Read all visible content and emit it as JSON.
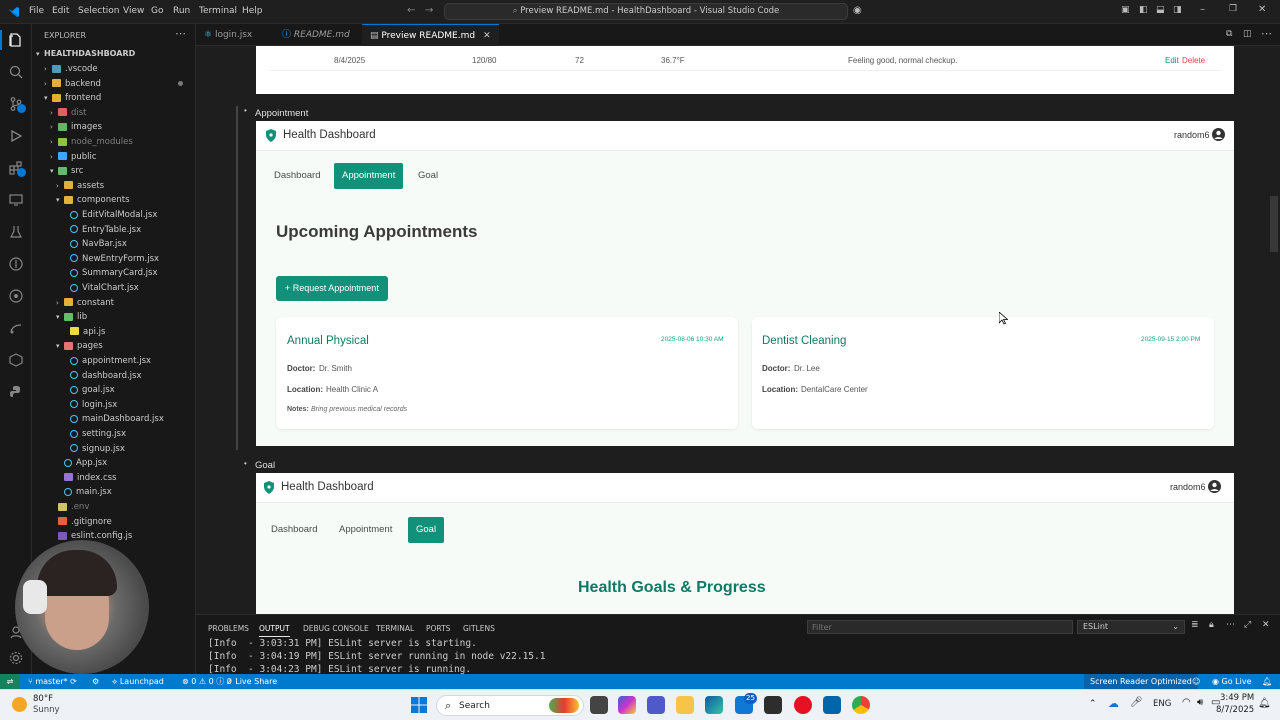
{
  "titlebar": {
    "menu": [
      "File",
      "Edit",
      "Selection",
      "View",
      "Go",
      "Run",
      "Terminal",
      "Help"
    ],
    "command_center": "Preview README.md - HealthDashboard - Visual Studio Code"
  },
  "explorer": {
    "header": "EXPLORER",
    "root": "HEALTHDASHBOARD",
    "items": [
      {
        "label": ".vscode",
        "depth": 1,
        "kind": "folder-closed",
        "color": "#519aba"
      },
      {
        "label": "backend",
        "depth": 1,
        "kind": "folder-closed",
        "color": "#e2b13c"
      },
      {
        "label": "frontend",
        "depth": 1,
        "kind": "folder-open",
        "color": "#e2b13c"
      },
      {
        "label": "dist",
        "depth": 2,
        "kind": "folder-closed",
        "color": "#e05f5f",
        "dim": true
      },
      {
        "label": "images",
        "depth": 2,
        "kind": "folder-closed",
        "color": "#5fb85f"
      },
      {
        "label": "node_modules",
        "depth": 2,
        "kind": "folder-closed",
        "color": "#8bc34a",
        "dim": true
      },
      {
        "label": "public",
        "depth": 2,
        "kind": "folder-closed",
        "color": "#42a5f5"
      },
      {
        "label": "src",
        "depth": 2,
        "kind": "folder-open",
        "color": "#66bb6a"
      },
      {
        "label": "assets",
        "depth": 3,
        "kind": "folder-closed",
        "color": "#e2b13c"
      },
      {
        "label": "components",
        "depth": 3,
        "kind": "folder-open",
        "color": "#e2b13c"
      },
      {
        "label": "EditVitalModal.jsx",
        "depth": 4,
        "kind": "react",
        "color": "#4fc3f7"
      },
      {
        "label": "EntryTable.jsx",
        "depth": 4,
        "kind": "react",
        "color": "#4fc3f7"
      },
      {
        "label": "NavBar.jsx",
        "depth": 4,
        "kind": "react",
        "color": "#4fc3f7"
      },
      {
        "label": "NewEntryForm.jsx",
        "depth": 4,
        "kind": "react",
        "color": "#4fc3f7"
      },
      {
        "label": "SummaryCard.jsx",
        "depth": 4,
        "kind": "react",
        "color": "#4fc3f7"
      },
      {
        "label": "VitalChart.jsx",
        "depth": 4,
        "kind": "react",
        "color": "#4fc3f7"
      },
      {
        "label": "constant",
        "depth": 3,
        "kind": "folder-closed",
        "color": "#e2b13c"
      },
      {
        "label": "lib",
        "depth": 3,
        "kind": "folder-open",
        "color": "#66bb6a"
      },
      {
        "label": "api.js",
        "depth": 4,
        "kind": "js",
        "color": "#f0d84a"
      },
      {
        "label": "pages",
        "depth": 3,
        "kind": "folder-open",
        "color": "#e57373"
      },
      {
        "label": "appointment.jsx",
        "depth": 4,
        "kind": "react",
        "color": "#4fc3f7"
      },
      {
        "label": "dashboard.jsx",
        "depth": 4,
        "kind": "react",
        "color": "#4fc3f7"
      },
      {
        "label": "goal.jsx",
        "depth": 4,
        "kind": "react",
        "color": "#4fc3f7"
      },
      {
        "label": "login.jsx",
        "depth": 4,
        "kind": "react",
        "color": "#4fc3f7"
      },
      {
        "label": "mainDashboard.jsx",
        "depth": 4,
        "kind": "react",
        "color": "#4fc3f7"
      },
      {
        "label": "setting.jsx",
        "depth": 4,
        "kind": "react",
        "color": "#4fc3f7"
      },
      {
        "label": "signup.jsx",
        "depth": 4,
        "kind": "react",
        "color": "#4fc3f7"
      },
      {
        "label": "App.jsx",
        "depth": 3,
        "kind": "react",
        "color": "#4fc3f7"
      },
      {
        "label": "index.css",
        "depth": 3,
        "kind": "css",
        "color": "#9575cd"
      },
      {
        "label": "main.jsx",
        "depth": 3,
        "kind": "react",
        "color": "#4fc3f7"
      },
      {
        "label": ".env",
        "depth": 2,
        "kind": "env",
        "color": "#d4c26a",
        "dim": true
      },
      {
        "label": ".gitignore",
        "depth": 2,
        "kind": "git",
        "color": "#e0643a"
      },
      {
        "label": "eslint.config.js",
        "depth": 2,
        "kind": "eslint",
        "color": "#7e57c2"
      }
    ]
  },
  "tabs": [
    {
      "label": "login.jsx",
      "active": false,
      "italic": false
    },
    {
      "label": "README.md",
      "active": false,
      "italic": true
    },
    {
      "label": "Preview README.md",
      "active": true,
      "italic": false
    }
  ],
  "preview": {
    "vitals_row": {
      "date": "8/4/2025",
      "bp": "120/80",
      "hr": "72",
      "temp": "36.7°F",
      "notes": "Feeling good, normal checkup.",
      "edit": "Edit",
      "delete": "Delete"
    },
    "appointment_bullet": "Appointment",
    "goal_bullet": "Goal",
    "app_title": "Health Dashboard",
    "username": "random6",
    "nav": [
      "Dashboard",
      "Appointment",
      "Goal"
    ],
    "appointments_heading": "Upcoming Appointments",
    "request_button": "+ Request Appointment",
    "appointments": [
      {
        "title": "Annual Physical",
        "datetime": "2025-08-06 10:30 AM",
        "doctor_label": "Doctor:",
        "doctor": "Dr. Smith",
        "location_label": "Location:",
        "location": "Health Clinic A",
        "notes_label": "Notes:",
        "notes": "Bring previous medical records"
      },
      {
        "title": "Dentist Cleaning",
        "datetime": "2025-09-15 2:00 PM",
        "doctor_label": "Doctor:",
        "doctor": "Dr. Lee",
        "location_label": "Location:",
        "location": "DentalCare Center"
      }
    ],
    "goals_heading": "Health Goals & Progress"
  },
  "panel": {
    "tabs": [
      "PROBLEMS",
      "OUTPUT",
      "DEBUG CONSOLE",
      "TERMINAL",
      "PORTS",
      "GITLENS"
    ],
    "active_tab": "OUTPUT",
    "filter_placeholder": "Filter",
    "channel": "ESLint",
    "lines": [
      "[Info  - 3:03:31 PM] ESLint server is starting.",
      "[Info  - 3:04:19 PM] ESLint server running in node v22.15.1",
      "[Info  - 3:04:23 PM] ESLint server is running."
    ]
  },
  "statusbar": {
    "branch": "master*",
    "launchpad": "Launchpad",
    "errors": "0",
    "warnings": "0",
    "info": "0",
    "live_share": "Live Share",
    "screen_reader": "Screen Reader Optimized",
    "go_live": "Go Live"
  },
  "taskbar": {
    "weather_temp": "80°F",
    "weather_desc": "Sunny",
    "search": "Search",
    "badge": "25",
    "lang": "ENG",
    "time": "3:49 PM",
    "date": "8/7/2025"
  },
  "colors": {
    "accent": "#12917a",
    "vscode_blue": "#007acc",
    "date_green": "#1aa082"
  }
}
